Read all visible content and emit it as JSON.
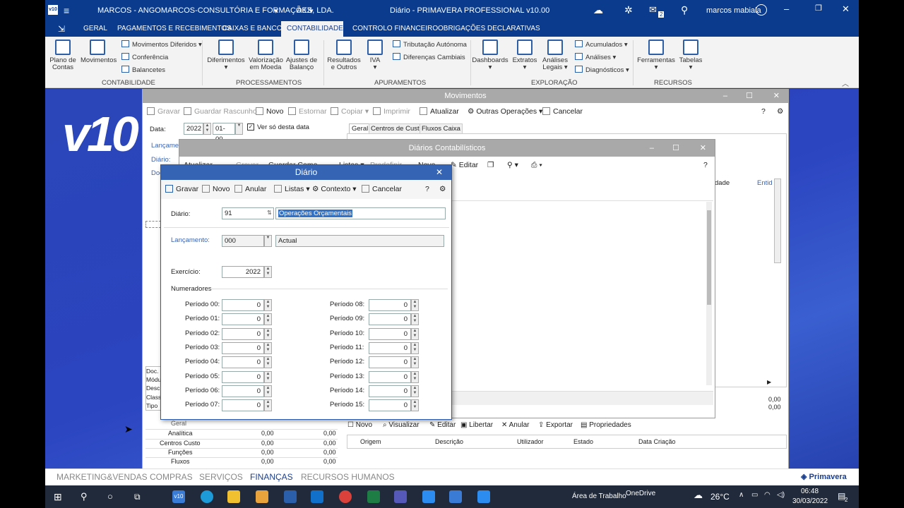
{
  "titlebar": {
    "company": "MARCOS - ANGOMARCOS-CONSULTÓRIA E FORMAÇÕES, LDA.",
    "currency": "AKZ",
    "app": "Diário - PRIMAVERA PROFESSIONAL v10.00",
    "user": "marcos mabiala",
    "notif_count": "2"
  },
  "ribbon_tabs": [
    "GERAL",
    "PAGAMENTOS E RECEBIMENTOS",
    "CAIXAS E BANCOS",
    "CONTABILIDADE",
    "CONTROLO FINANCEIRO",
    "OBRIGAÇÕES DECLARATIVAS"
  ],
  "ribbon": {
    "plano": "Plano de Contas",
    "movimentos": "Movimentos",
    "mov_diferidos": "Movimentos Diferidos",
    "conferencia": "Conferência",
    "balancetes": "Balancetes",
    "g_contab": "CONTABILIDADE",
    "diferimentos": "Diferimentos",
    "valorizacao": "Valorização em Moeda",
    "ajustes": "Ajustes de Balanço",
    "g_proc": "PROCESSAMENTOS",
    "resultados": "Resultados e Outros",
    "iva": "IVA",
    "tributacao": "Tributação Autónoma",
    "diferencas": "Diferenças Cambiais",
    "g_apur": "APURAMENTOS",
    "dashboards": "Dashboards",
    "extratos": "Extratos",
    "analises_legais": "Análises Legais",
    "acumulados": "Acumulados",
    "analises": "Análises",
    "diagnosticos": "Diagnósticos",
    "g_expl": "EXPLORAÇÃO",
    "ferramentas": "Ferramentas",
    "tabelas": "Tabelas",
    "g_rec": "RECURSOS"
  },
  "movimentos": {
    "title": "Movimentos",
    "toolbar": [
      "Gravar",
      "Guardar Rascunho",
      "Novo",
      "Estornar",
      "Copiar",
      "Imprimir",
      "Atualizar",
      "Outras Operações",
      "Cancelar"
    ],
    "data_label": "Data:",
    "year": "2022",
    "month": "01-00",
    "ver_so": "Ver só desta data",
    "tabs": [
      "Geral",
      "Centros de Custo",
      "Fluxos Caixa"
    ],
    "lancamento": "Lançamen",
    "diario": "Diário:",
    "doc": "Doc",
    "bottom_labels": [
      "Doc.",
      "Módu",
      "Desc",
      "Class",
      "Tipo"
    ],
    "summary_rows": [
      {
        "label": "Geral",
        "a": "",
        "b": ""
      },
      {
        "label": "Analítica",
        "a": "0,00",
        "b": "0,00"
      },
      {
        "label": "Centros Custo",
        "a": "0,00",
        "b": "0,00"
      },
      {
        "label": "Funções",
        "a": "0,00",
        "b": "0,00"
      },
      {
        "label": "Fluxos",
        "a": "0,00",
        "b": "0,00"
      }
    ],
    "bottom_toolbar": [
      "Novo",
      "Visualizar",
      "Editar",
      "Libertar",
      "Anular",
      "Exportar",
      "Propriedades"
    ],
    "grid_headers": [
      "Origem",
      "Descrição",
      "Utilizador",
      "Estado",
      "Data Criação"
    ],
    "totals": [
      "0,00",
      "0,00"
    ],
    "col_dade": "dade",
    "col_entid": "Entid"
  },
  "diarios": {
    "title": "Diários Contabilísticos",
    "toolbar": [
      "Atualizar",
      "Gravar",
      "Guardar Como",
      "Listas",
      "Predefinir",
      "Novo",
      "Editar"
    ]
  },
  "dialog": {
    "title": "Diário",
    "toolbar": [
      "Gravar",
      "Novo",
      "Anular",
      "Listas",
      "Contexto",
      "Cancelar"
    ],
    "diario_label": "Diário:",
    "diario_code": "91",
    "diario_desc": "Operações Orçamentais",
    "lancamento_label": "Lançamento:",
    "lancamento_code": "000",
    "lancamento_desc": "Actual",
    "exercicio_label": "Exercício:",
    "exercicio": "2022",
    "numeradores": "Numeradores",
    "left": [
      {
        "l": "Período 00:",
        "v": "0"
      },
      {
        "l": "Período 01:",
        "v": "0"
      },
      {
        "l": "Período 02:",
        "v": "0"
      },
      {
        "l": "Período 03:",
        "v": "0"
      },
      {
        "l": "Período 04:",
        "v": "0"
      },
      {
        "l": "Período 05:",
        "v": "0"
      },
      {
        "l": "Período 06:",
        "v": "0"
      },
      {
        "l": "Período 07:",
        "v": "0"
      }
    ],
    "right": [
      {
        "l": "Período 08:",
        "v": "0"
      },
      {
        "l": "Período 09:",
        "v": "0"
      },
      {
        "l": "Período 10:",
        "v": "0"
      },
      {
        "l": "Período 11:",
        "v": "0"
      },
      {
        "l": "Período 12:",
        "v": "0"
      },
      {
        "l": "Período 13:",
        "v": "0"
      },
      {
        "l": "Período 14:",
        "v": "0"
      },
      {
        "l": "Período 15:",
        "v": "0"
      }
    ]
  },
  "app_tabs": [
    "MARKETING&VENDAS",
    "COMPRAS",
    "SERVIÇOS",
    "FINANÇAS",
    "RECURSOS HUMANOS"
  ],
  "brand": "Primavera",
  "taskbar": {
    "area": "Área de Trabalho",
    "onedrive": "OneDrive",
    "temp": "26°C",
    "time": "06:48",
    "date": "30/03/2022",
    "notif": "2"
  }
}
